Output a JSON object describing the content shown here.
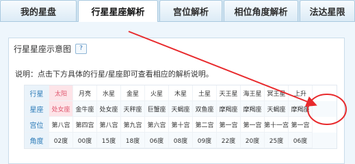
{
  "tabs": [
    {
      "label": "我的星盘"
    },
    {
      "label": "行星星座解析"
    },
    {
      "label": "宫位解析"
    },
    {
      "label": "相位角度解析"
    },
    {
      "label": "法达星限"
    }
  ],
  "panel": {
    "title": "行星星座示意图",
    "help": "?",
    "description": "说明：点击下方具体的行星/星座即可查看相应的解析说明。"
  },
  "table": {
    "headers": {
      "planet": "行星",
      "sign": "星座",
      "house": "宫位",
      "degree": "角度"
    },
    "columns": [
      {
        "planet": "太阳",
        "sign": "处女座",
        "house": "第八宫",
        "degree": "02度"
      },
      {
        "planet": "月亮",
        "sign": "金牛座",
        "house": "第四宫",
        "degree": "00度"
      },
      {
        "planet": "水星",
        "sign": "处女座",
        "house": "第八宫",
        "degree": "15度"
      },
      {
        "planet": "金星",
        "sign": "天秤座",
        "house": "第九宫",
        "degree": "18度"
      },
      {
        "planet": "火星",
        "sign": "巨蟹座",
        "house": "第六宫",
        "degree": "06度"
      },
      {
        "planet": "木星",
        "sign": "天蝎座",
        "house": "第十宫",
        "degree": "08度"
      },
      {
        "planet": "土星",
        "sign": "双鱼座",
        "house": "第二宫",
        "degree": "09度"
      },
      {
        "planet": "天王星",
        "sign": "摩羯座",
        "house": "第一宫",
        "degree": "22度"
      },
      {
        "planet": "海王星",
        "sign": "摩羯座",
        "house": "第一宫",
        "degree": "20度"
      },
      {
        "planet": "冥王星",
        "sign": "天蝎座",
        "house": "第十一宫",
        "degree": "25度"
      },
      {
        "planet": "上升",
        "sign": "摩羯座",
        "house": "第一宫",
        "degree": "06度"
      }
    ]
  },
  "colors": {
    "accent": "#2a7ab7",
    "highlight": "#e0566e",
    "annotation": "#e8292c"
  }
}
